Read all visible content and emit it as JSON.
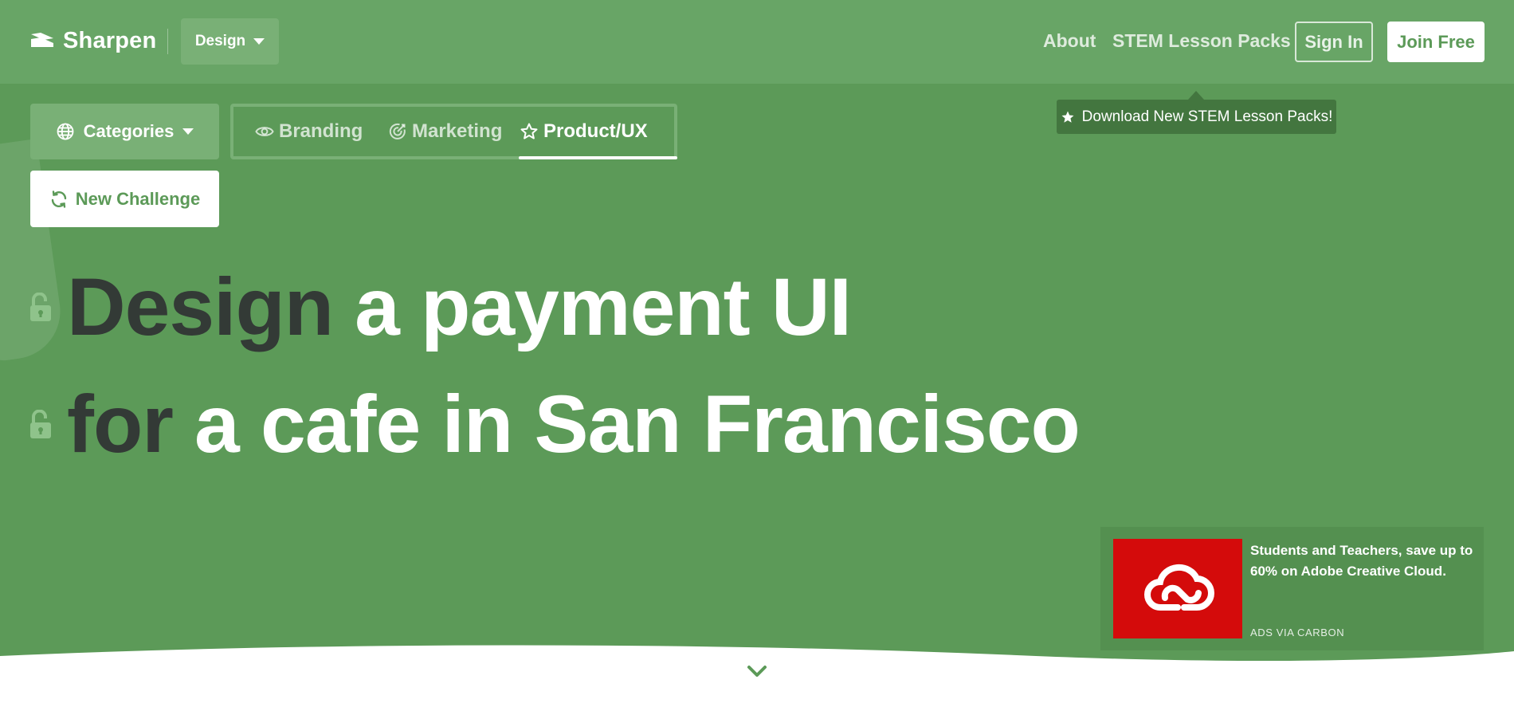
{
  "header": {
    "logo_text": "Sharpen",
    "design_dropdown": "Design",
    "nav": {
      "about": "About",
      "stem": "STEM Lesson Packs",
      "sign_in": "Sign In",
      "join": "Join Free"
    },
    "tooltip": "Download New STEM Lesson Packs!"
  },
  "toolbar": {
    "categories": "Categories",
    "tabs": [
      {
        "label": "Branding",
        "icon": "eye-icon",
        "active": false
      },
      {
        "label": "Marketing",
        "icon": "target-icon",
        "active": false
      },
      {
        "label": "Product/UX",
        "icon": "star-icon",
        "active": true
      }
    ],
    "new_challenge": "New Challenge"
  },
  "challenge": {
    "line1_keyword": "Design",
    "line1_rest": "a payment UI",
    "line2_keyword": "for",
    "line2_rest": "a cafe in San Francisco"
  },
  "ad": {
    "text": "Students and Teachers, save up to 60% on Adobe Creative Cloud.",
    "via": "ADS VIA CARBON"
  },
  "colors": {
    "background": "#5c9a58",
    "header": "#68a566",
    "keyword": "#333a36",
    "ad_image": "#d40b0b",
    "tooltip": "#43763f"
  }
}
